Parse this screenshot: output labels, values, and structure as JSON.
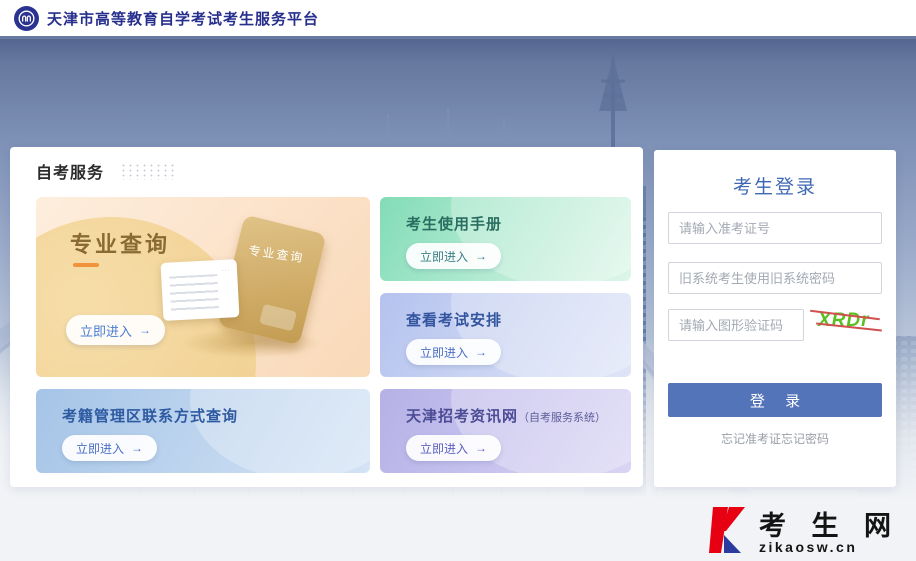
{
  "header": {
    "title": "天津市高等教育自学考试考生服务平台"
  },
  "services": {
    "section_title": "自考服务",
    "enter_arrow": "→",
    "cards": [
      {
        "id": "major-query",
        "title": "专业查询",
        "button": "立即进入",
        "illustration_label": "专业查询"
      },
      {
        "id": "student-manual",
        "title": "考生使用手册",
        "button": "立即进入"
      },
      {
        "id": "exam-schedule",
        "title": "查看考试安排",
        "button": "立即进入"
      },
      {
        "id": "district-contact",
        "title": "考籍管理区联系方式查询",
        "button": "立即进入"
      },
      {
        "id": "zhaokao-site",
        "title": "天津招考资讯网",
        "subtitle": "（自考服务系统）",
        "button": "立即进入"
      }
    ]
  },
  "login": {
    "title": "考生登录",
    "inputs": [
      {
        "placeholder": "请输入准考证号"
      },
      {
        "placeholder": "旧系统考生使用旧系统密码"
      },
      {
        "placeholder": "请输入图形验证码"
      }
    ],
    "captcha_text": "XRDr",
    "login_button": "登 录",
    "forgot_link": "忘记准考证忘记密码"
  },
  "watermark": {
    "name": "考 生 网",
    "domain": "zikaosw.cn"
  },
  "colors": {
    "header_navy": "#272f8d",
    "login_button_blue": "#5474ba",
    "captcha_green": "#5abf20",
    "watermark_red": "#e60012",
    "watermark_blue": "#2b3a9e"
  },
  "doc_dots": "..."
}
